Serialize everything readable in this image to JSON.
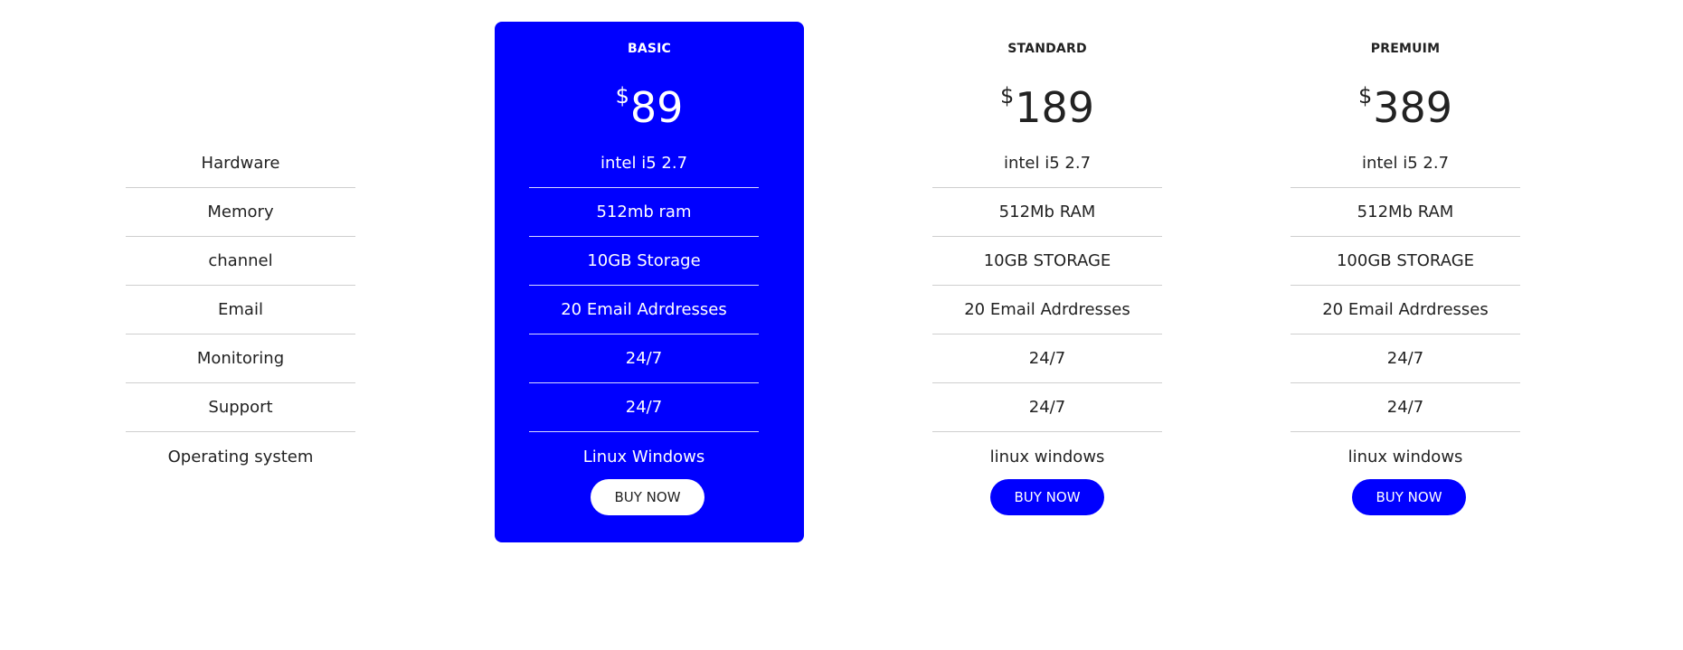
{
  "features": [
    "Hardware",
    "Memory",
    "channel",
    "Email",
    "Monitoring",
    "Support",
    "Operating system"
  ],
  "plans": {
    "basic": {
      "name": "BASIC",
      "currency": "$",
      "price": "89",
      "rows": [
        "intel i5 2.7",
        "512mb ram",
        "10GB Storage",
        "20 Email Adrdresses",
        "24/7",
        "24/7",
        "Linux Windows"
      ],
      "button": "BUY NOW"
    },
    "standard": {
      "name": "STANDARD",
      "currency": "$",
      "price": "189",
      "rows": [
        "intel i5 2.7",
        "512Mb RAM",
        "10GB STORAGE",
        "20 Email Adrdresses",
        "24/7",
        "24/7",
        "linux windows"
      ],
      "button": "BUY NOW"
    },
    "premium": {
      "name": "PREMUIM",
      "currency": "$",
      "price": "389",
      "rows": [
        "intel i5 2.7",
        "512Mb RAM",
        "100GB STORAGE",
        "20 Email Adrdresses",
        "24/7",
        "24/7",
        "linux windows"
      ],
      "button": "BUY NOW"
    }
  },
  "colors": {
    "accent": "#0000ff",
    "text": "#222222",
    "divider": "#cfcfcf",
    "background": "#ffffff"
  }
}
